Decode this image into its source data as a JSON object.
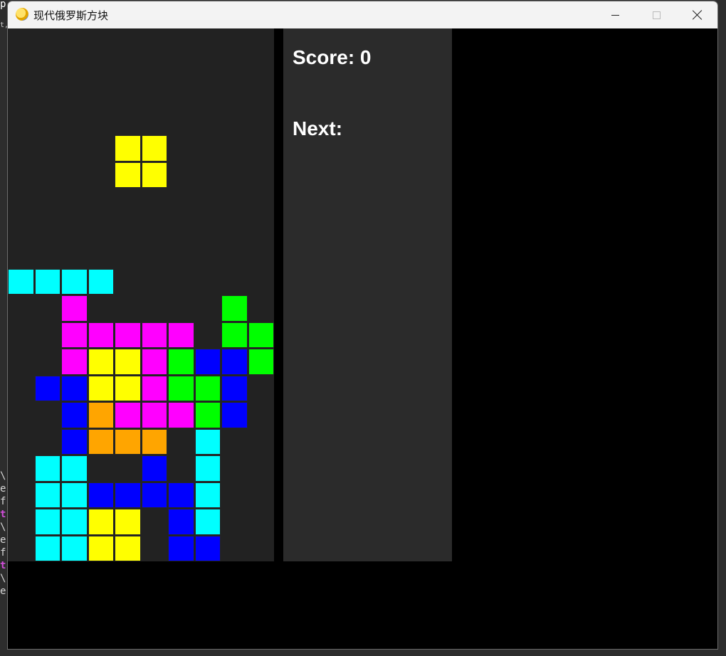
{
  "window": {
    "title": "现代俄罗斯方块"
  },
  "panel": {
    "score_label": "Score: 0",
    "next_label": "Next:"
  },
  "colors": {
    "Y": "#ffff00",
    "C": "#00ffff",
    "M": "#ff00ff",
    "G": "#00ff00",
    "B": "#0000ff",
    "O": "#ffa500"
  },
  "board": {
    "columns": 10,
    "rows": 20,
    "falling_piece": {
      "type": "O",
      "color": "Y",
      "cells": [
        [
          4,
          4
        ],
        [
          5,
          4
        ],
        [
          4,
          5
        ],
        [
          5,
          5
        ]
      ]
    },
    "grid": [
      "..........",
      "..........",
      "..........",
      "..........",
      "..........",
      "..........",
      "..........",
      "..........",
      "..........",
      "CCCC......",
      "..M.....G.",
      "..MMMMM.GG",
      "..MYYMGBBG",
      ".BBYYMGGB.",
      "..BOMMMGB.",
      "..BOOO.C..",
      ".CC..B.C..",
      ".CCBBBBC..",
      ".CCYY.BC..",
      ".CCYY.BB.."
    ]
  }
}
